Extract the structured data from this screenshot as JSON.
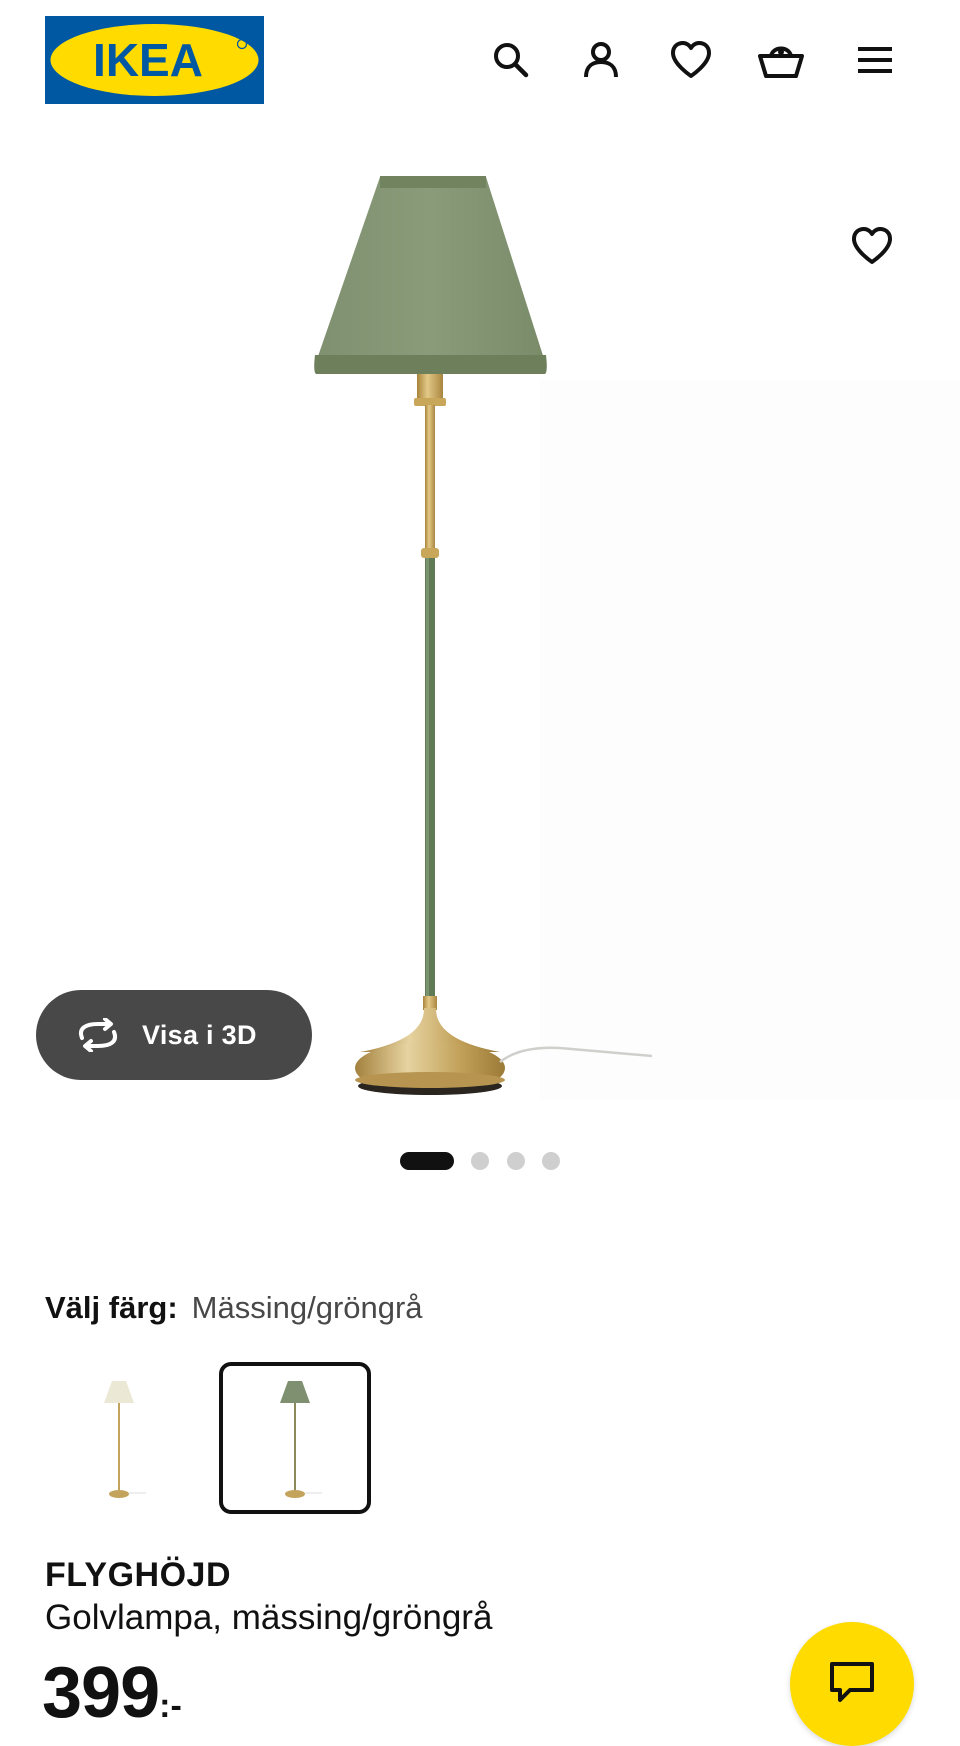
{
  "header": {
    "logo_text": "IKEA",
    "icons": [
      "search-icon",
      "user-icon",
      "heart-icon",
      "basket-icon",
      "menu-icon"
    ]
  },
  "gallery": {
    "view_3d_label": "Visa i 3D",
    "slide_count": 4,
    "active_slide": 1
  },
  "product": {
    "color_label": "Välj färg:",
    "color_value": "Mässing/gröngrå",
    "color_options": [
      "Mässing/vit",
      "Mässing/gröngrå"
    ],
    "selected_color_index": 1,
    "name": "FLYGHÖJD",
    "description": "Golvlampa, mässing/gröngrå",
    "price": "399",
    "price_suffix": ":-"
  },
  "colors": {
    "brand_blue": "#0058a3",
    "brand_yellow": "#ffdb00",
    "shade_green": "#7d8f6c",
    "brass": "#c9a75a"
  }
}
